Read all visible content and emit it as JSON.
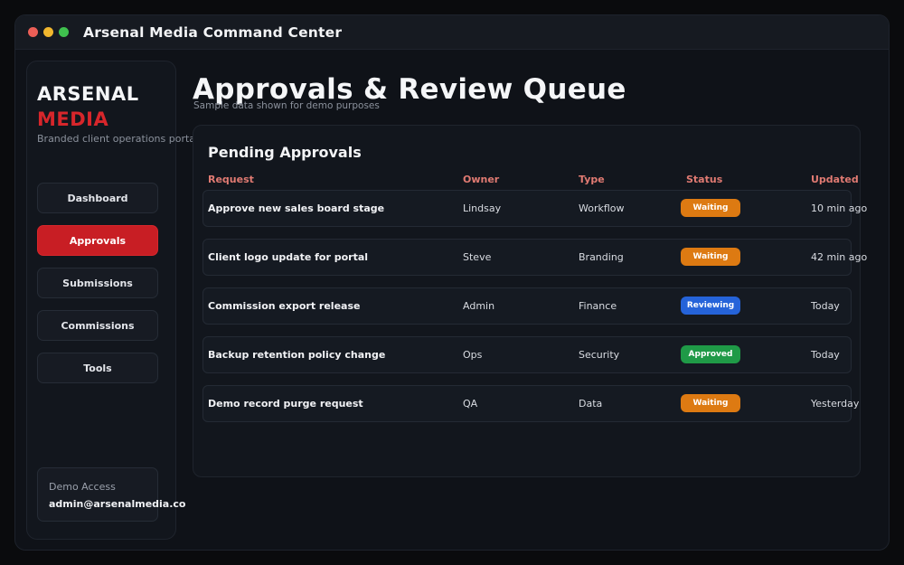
{
  "window": {
    "title": "Arsenal Media Command Center",
    "traffic_lights": [
      "#ec5f57",
      "#f1b72e",
      "#3fc14e"
    ]
  },
  "sidebar": {
    "brand_line1": "ARSENAL",
    "brand_line2": "MEDIA",
    "brand_line2_color": "#d7262b",
    "tagline": "Branded client operations portal",
    "nav": [
      {
        "label": "Dashboard",
        "active": false
      },
      {
        "label": "Approvals",
        "active": true
      },
      {
        "label": "Submissions",
        "active": false
      },
      {
        "label": "Commissions",
        "active": false
      },
      {
        "label": "Tools",
        "active": false
      }
    ],
    "demo_access": {
      "label": "Demo Access",
      "email": "admin@arsenalmedia.co"
    }
  },
  "main": {
    "title": "Approvals & Review Queue",
    "subtitle": "Sample data shown for demo purposes",
    "panel": {
      "title": "Pending Approvals",
      "header_color": "#e07a72",
      "columns": [
        "Request",
        "Owner",
        "Type",
        "Status",
        "Updated"
      ],
      "rows": [
        {
          "request": "Approve new sales board stage",
          "owner": "Lindsay",
          "type": "Workflow",
          "status": "Waiting",
          "updated": "10 min ago"
        },
        {
          "request": "Client logo update for portal",
          "owner": "Steve",
          "type": "Branding",
          "status": "Waiting",
          "updated": "42 min ago"
        },
        {
          "request": "Commission export release",
          "owner": "Admin",
          "type": "Finance",
          "status": "Reviewing",
          "updated": "Today"
        },
        {
          "request": "Backup retention policy change",
          "owner": "Ops",
          "type": "Security",
          "status": "Approved",
          "updated": "Today"
        },
        {
          "request": "Demo record purge request",
          "owner": "QA",
          "type": "Data",
          "status": "Waiting",
          "updated": "Yesterday"
        }
      ],
      "status_colors": {
        "Waiting": "#dd7a12",
        "Reviewing": "#2563d9",
        "Approved": "#1f9a47"
      }
    }
  },
  "accent": {
    "active_nav_bg": "#c81e24"
  }
}
